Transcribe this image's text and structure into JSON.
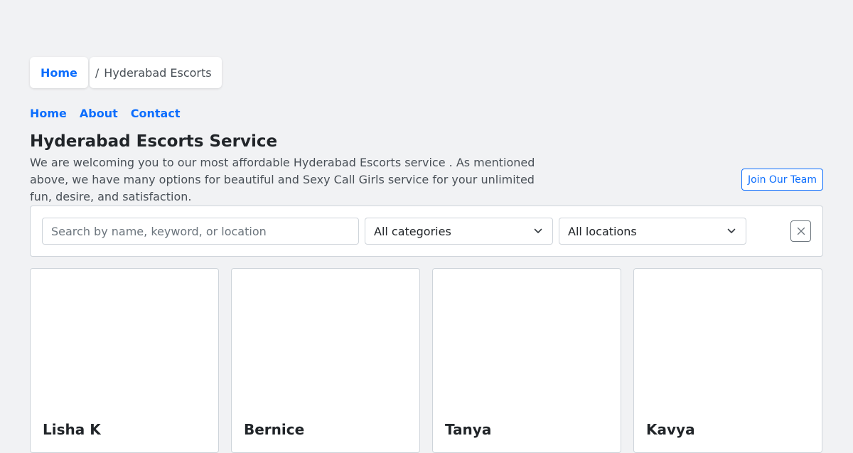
{
  "breadcrumb": {
    "home_label": "Home",
    "separator": "/",
    "current_label": "Hyderabad Escorts"
  },
  "nav": {
    "items": [
      {
        "label": "Home"
      },
      {
        "label": "About"
      },
      {
        "label": "Contact"
      }
    ]
  },
  "page": {
    "title": "Hyderabad Escorts Service",
    "intro": "We are welcoming you to our most affordable Hyderabad Escorts service . As mentioned above, we have many options for beautiful and Sexy Call Girls service for your unlimited fun, desire, and satisfaction.",
    "join_button_label": "Join Our Team"
  },
  "filters": {
    "search_value": "",
    "search_placeholder": "Search by name, keyword, or location",
    "category_selected": "All categories",
    "location_selected": "All locations",
    "clear_icon": "close-icon"
  },
  "cards": [
    {
      "name": "Lisha K"
    },
    {
      "name": "Bernice"
    },
    {
      "name": "Tanya"
    },
    {
      "name": "Kavya"
    }
  ],
  "colors": {
    "accent": "#0d6efd",
    "background": "#f1f2f4",
    "text": "#212529",
    "muted_text": "#495057",
    "border": "#ced4da"
  }
}
